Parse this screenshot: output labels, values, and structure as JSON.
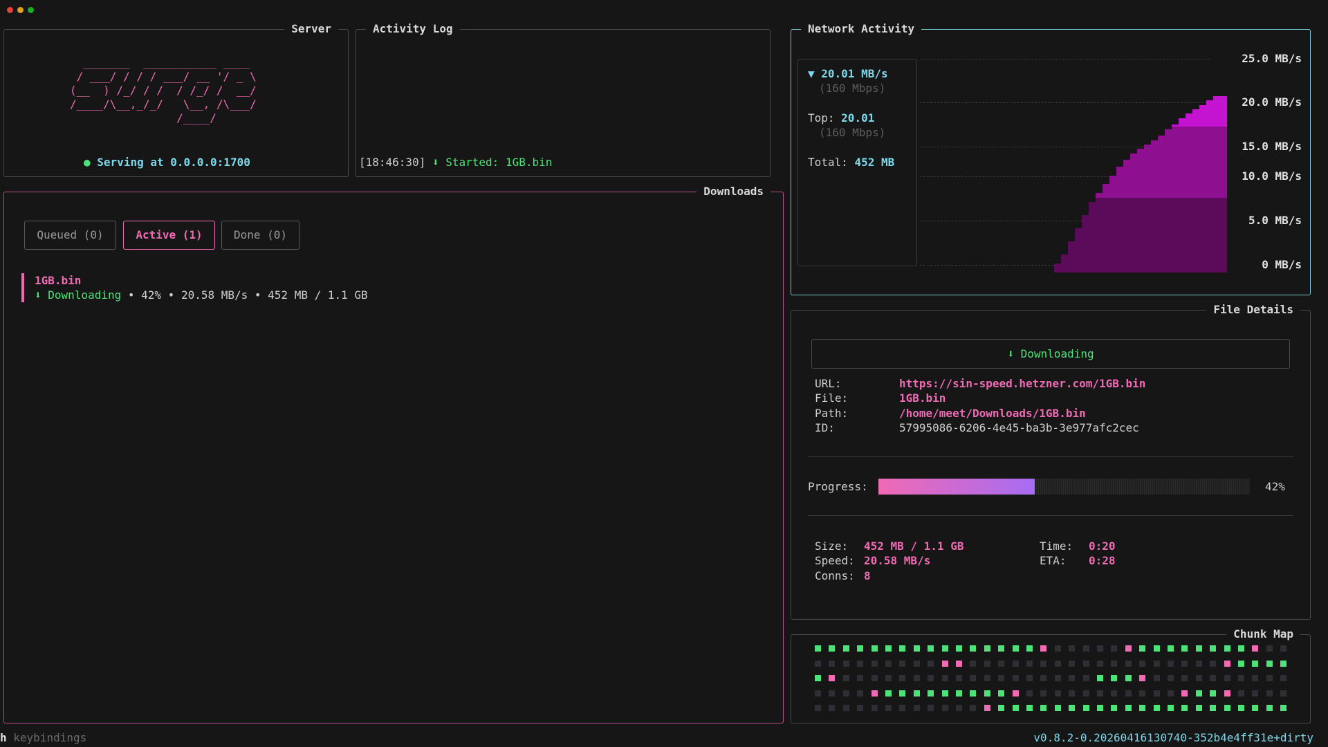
{
  "window": {
    "dots": [
      "#e0443e",
      "#dea123",
      "#1aab29"
    ]
  },
  "server": {
    "title": "Server",
    "logo_ascii": "  _______  ___________ ____\n / ___/ / / / ___/ __ '/ _ \\\n(__  ) /_/ / /  / /_/ /  __/\n/____/\\__,_/_/   \\__, /\\___/\n                /____/",
    "status": "Serving at 0.0.0.0:1700"
  },
  "activity_log": {
    "title": "Activity Log",
    "entries": [
      {
        "time": "[18:46:30]",
        "message": "⬇ Started: 1GB.bin"
      }
    ]
  },
  "network": {
    "title": "Network Activity",
    "current_speed": "▼ 20.01 MB/s",
    "current_mbps": "(160 Mbps)",
    "top_label": "Top:",
    "top_value": "20.01",
    "top_mbps": "(160 Mbps)",
    "total_label": "Total:",
    "total_value": "452 MB",
    "y_labels": [
      "25.0 MB/s",
      "20.0 MB/s",
      "15.0 MB/s",
      "10.0 MB/s",
      "5.0 MB/s",
      "0 MB/s"
    ]
  },
  "chart_data": {
    "type": "area",
    "title": "",
    "xlabel": "",
    "ylabel": "",
    "ylim": [
      0,
      25
    ],
    "y_ticks": [
      "0 MB/s",
      "5.0 MB/s",
      "10.0 MB/s",
      "15.0 MB/s",
      "20.0 MB/s",
      "25.0 MB/s"
    ],
    "grid": true,
    "series": [
      {
        "values": [
          1.0,
          2.0,
          3.5,
          5.0,
          6.5,
          8.0,
          9.0,
          10.0,
          11.0,
          12.0,
          12.8,
          13.5,
          14.0,
          14.5,
          15.0,
          15.5,
          16.2,
          16.8,
          17.5,
          18.0,
          18.5,
          19.0,
          19.5,
          20.0,
          20.01
        ]
      }
    ],
    "colors": [
      "#5c0b5a",
      "#8e0f90",
      "#c414d2"
    ]
  },
  "downloads": {
    "title": "Downloads",
    "tabs": [
      {
        "label": "Queued (0)",
        "active": false
      },
      {
        "label": "Active (1)",
        "active": true
      },
      {
        "label": "Done (0)",
        "active": false
      }
    ],
    "items": [
      {
        "name": "1GB.bin",
        "status": "⬇ Downloading",
        "detail": "• 42% • 20.58 MB/s • 452 MB / 1.1 GB"
      }
    ]
  },
  "file_details": {
    "title": "File Details",
    "state_badge": "⬇ Downloading",
    "url_label": "URL:",
    "url": "https://sin-speed.hetzner.com/1GB.bin",
    "file_label": "File:",
    "file": "1GB.bin",
    "path_label": "Path:",
    "path": "/home/meet/Downloads/1GB.bin",
    "id_label": "ID:",
    "id": "57995086-6206-4e45-ba3b-3e977afc2cec",
    "progress_label": "Progress:",
    "progress_value": 0.42,
    "progress_text": "42%",
    "size_label": "Size:",
    "size": "452 MB / 1.1 GB",
    "speed_label": "Speed:",
    "speed": "20.58 MB/s",
    "conns_label": "Conns:",
    "conns": "8",
    "time_label": "Time:",
    "time": "0:20",
    "eta_label": "ETA:",
    "eta": "0:28"
  },
  "chunk_map": {
    "title": "Chunk Map",
    "rows": [
      "ggggggggggggggggp.....pggggggggp...",
      "........ pp..................pgggg",
      "gp..................gggp..........",
      "....pgggggggggp...........pggp....",
      "............pgggggggggggggggggggggg"
    ],
    "colors": {
      "g": "#4ee27a",
      "p": "#f06ab4",
      ".": "#2e2e34"
    }
  },
  "footer": {
    "key": "h",
    "hint": " keybindings",
    "version": "v0.8.2-0.20260416130740-352b4e4ff31e+dirty"
  }
}
